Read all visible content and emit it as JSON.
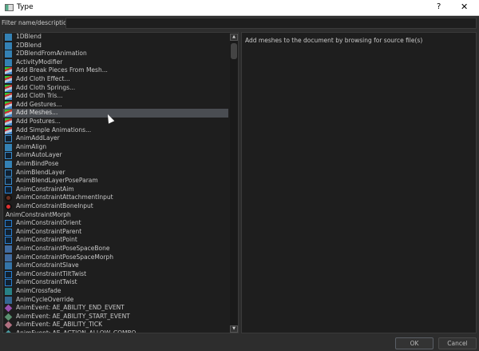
{
  "window": {
    "title": "Type",
    "help": "?",
    "close": "✕"
  },
  "filter": {
    "label": "Filter name/description:",
    "value": "",
    "placeholder": ""
  },
  "list": {
    "selected_index": 9,
    "items": [
      {
        "label": "1DBlend",
        "icon": "horizontal-arrows-icon"
      },
      {
        "label": "2DBlend",
        "icon": "cross-arrows-icon"
      },
      {
        "label": "2DBlendFromAnimation",
        "icon": "grid-arrows-icon"
      },
      {
        "label": "ActivityModifier",
        "icon": "figure-icon"
      },
      {
        "label": "Add Break Pieces From Mesh...",
        "icon": "mesh-tool-icon"
      },
      {
        "label": "Add Cloth Effect...",
        "icon": "mesh-tool-icon"
      },
      {
        "label": "Add Cloth Springs...",
        "icon": "mesh-tool-icon"
      },
      {
        "label": "Add Cloth Tris...",
        "icon": "mesh-tool-icon"
      },
      {
        "label": "Add Gestures...",
        "icon": "mesh-tool-icon"
      },
      {
        "label": "Add Meshes...",
        "icon": "mesh-tool-icon"
      },
      {
        "label": "Add Postures...",
        "icon": "mesh-tool-icon"
      },
      {
        "label": "Add Simple Animations...",
        "icon": "mesh-tool-icon"
      },
      {
        "label": "AnimAddLayer",
        "icon": "layer-icon"
      },
      {
        "label": "AnimAlign",
        "icon": "align-icon"
      },
      {
        "label": "AnimAutoLayer",
        "icon": "layer-icon"
      },
      {
        "label": "AnimBindPose",
        "icon": "figure-icon"
      },
      {
        "label": "AnimBlendLayer",
        "icon": "layer-icon"
      },
      {
        "label": "AnimBlendLayerPoseParam",
        "icon": "layer-icon"
      },
      {
        "label": "AnimConstraintAim",
        "icon": "link-icon"
      },
      {
        "label": "AnimConstraintAttachmentInput",
        "icon": "target-dim-icon"
      },
      {
        "label": "AnimConstraintBoneInput",
        "icon": "target-icon"
      },
      {
        "label": "AnimConstraintMorph",
        "icon": ""
      },
      {
        "label": "AnimConstraintOrient",
        "icon": "link-icon"
      },
      {
        "label": "AnimConstraintParent",
        "icon": "link-icon"
      },
      {
        "label": "AnimConstraintPoint",
        "icon": "link-icon"
      },
      {
        "label": "AnimConstraintPoseSpaceBone",
        "icon": "pose-icon"
      },
      {
        "label": "AnimConstraintPoseSpaceMorph",
        "icon": "pose-icon"
      },
      {
        "label": "AnimConstraintSlave",
        "icon": "slave-icon"
      },
      {
        "label": "AnimConstraintTiltTwist",
        "icon": "link-icon"
      },
      {
        "label": "AnimConstraintTwist",
        "icon": "link-icon"
      },
      {
        "label": "AnimCrossfade",
        "icon": "crossfade-icon"
      },
      {
        "label": "AnimCycleOverride",
        "icon": "cycle-icon"
      },
      {
        "label": "AnimEvent: AE_ABILITY_END_EVENT",
        "icon": "diamond-purple-icon"
      },
      {
        "label": "AnimEvent: AE_ABILITY_START_EVENT",
        "icon": "diamond-green-icon"
      },
      {
        "label": "AnimEvent: AE_ABILITY_TICK",
        "icon": "diamond-pink-icon"
      },
      {
        "label": "AnimEvent: AE_ACTION_ALLOW_COMBO",
        "icon": "diamond-teal-icon"
      }
    ]
  },
  "description": "Add meshes to the document by browsing for source file(s)",
  "buttons": {
    "ok": "OK",
    "cancel": "Cancel"
  },
  "icon_colors": {
    "horizontal-arrows-icon": "#3a9ad9",
    "cross-arrows-icon": "#3a9ad9",
    "grid-arrows-icon": "#3a9ad9",
    "figure-icon": "#3a9ad9",
    "mesh-tool-icon": "#c04040",
    "layer-icon": "#3a8ac9",
    "align-icon": "#3a9ad9",
    "link-icon": "#2a7fd0",
    "target-dim-icon": "#6a3020",
    "target-icon": "#e03030",
    "pose-icon": "#4a80c0",
    "slave-icon": "#3a8ac9",
    "crossfade-icon": "#2a9aa0",
    "cycle-icon": "#3a7ab0",
    "diamond-purple-icon": "#9a50b0",
    "diamond-green-icon": "#5a9070",
    "diamond-pink-icon": "#b07080",
    "diamond-teal-icon": "#4a9aa0"
  }
}
